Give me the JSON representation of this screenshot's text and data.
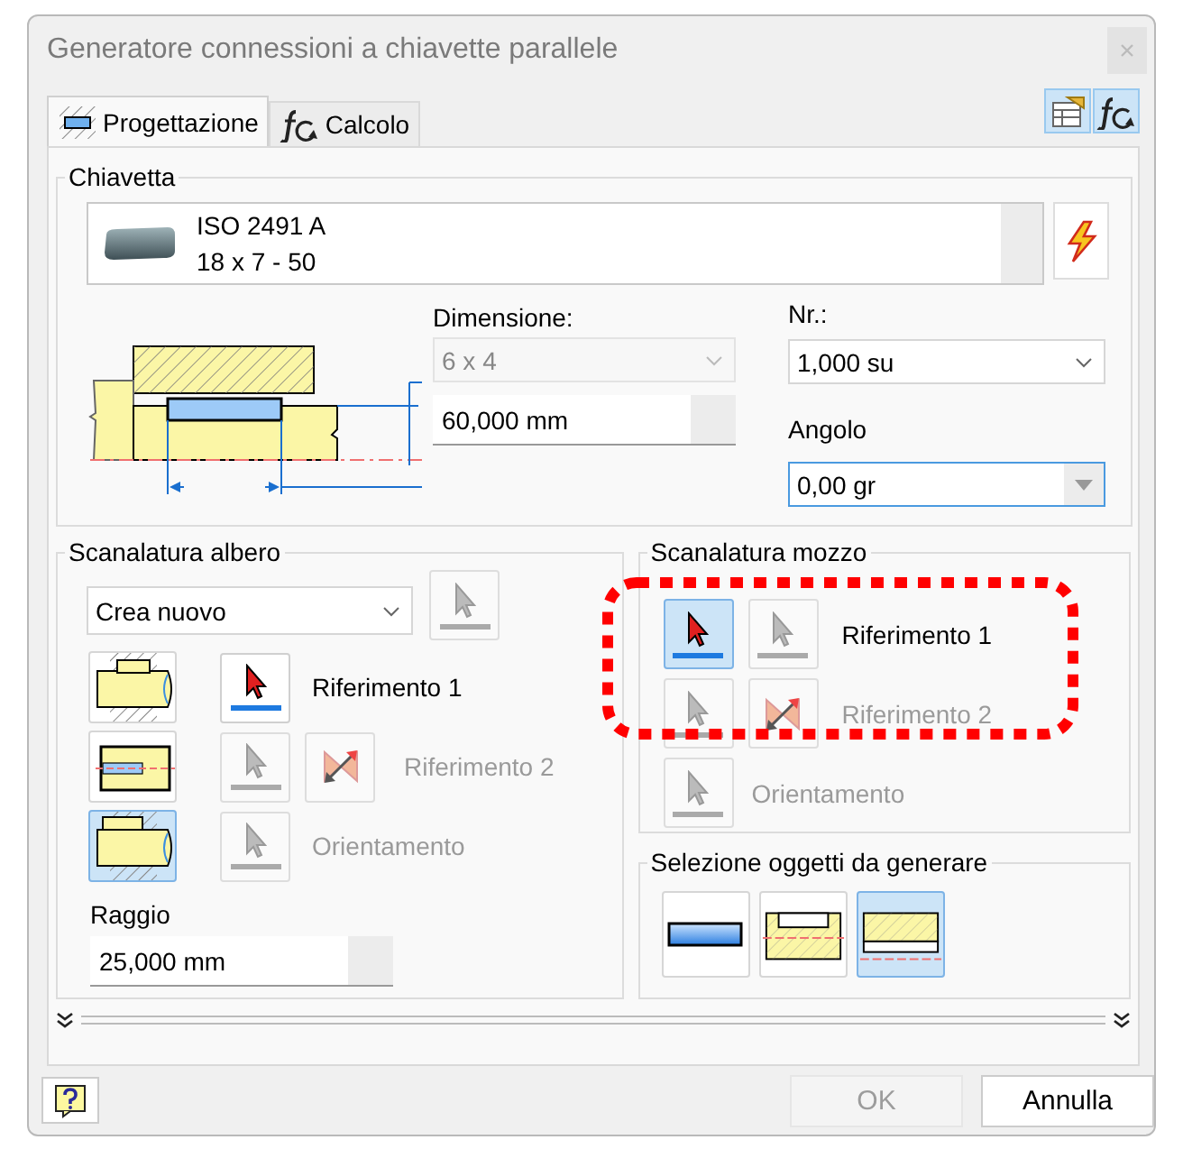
{
  "window": {
    "title": "Generatore connessioni a chiavette parallele"
  },
  "tabs": [
    {
      "label": "Progettazione",
      "kind": "design",
      "selected": true
    },
    {
      "label": "Calcolo",
      "kind": "formula",
      "selected": false
    }
  ],
  "toolbar_buttons": [
    {
      "kind": "table",
      "selected": true
    },
    {
      "kind": "formula",
      "selected": true
    }
  ],
  "key_section": {
    "title": "Chiavetta",
    "key_lines": [
      "ISO 2491 A",
      "18 x 7 - 50"
    ],
    "dimension": {
      "label": "Dimensione:",
      "value": "6 x 4",
      "disabled": true
    },
    "length": {
      "value": "60,000 mm"
    },
    "count": {
      "label": "Nr.:",
      "value": "1,000 su"
    },
    "angle": {
      "label": "Angolo",
      "value": "0,00 gr",
      "focused": true
    }
  },
  "shaft_groove": {
    "title": "Scanalatura albero",
    "mode": {
      "value": "Crea nuovo"
    },
    "mode_pick": {
      "disabled": true
    },
    "groove_types": [
      {
        "kind": "closed",
        "selected": false
      },
      {
        "kind": "flat",
        "selected": false
      },
      {
        "kind": "open",
        "selected": true
      }
    ],
    "references": [
      {
        "label": "Riferimento 1",
        "disabled": false,
        "buttons": [
          {
            "kind": "pick",
            "selected": false,
            "disabled": false
          }
        ]
      },
      {
        "label": "Riferimento 2",
        "disabled": true,
        "buttons": [
          {
            "kind": "pick",
            "selected": false,
            "disabled": true
          },
          {
            "kind": "flip",
            "selected": false,
            "disabled": true
          }
        ]
      },
      {
        "label": "Orientamento",
        "disabled": true,
        "buttons": [
          {
            "kind": "pick",
            "selected": false,
            "disabled": true
          }
        ]
      }
    ],
    "radius": {
      "label": "Raggio",
      "value": "25,000 mm"
    }
  },
  "hub_groove": {
    "title": "Scanalatura mozzo",
    "highlighted": true,
    "references": [
      {
        "label": "Riferimento 1",
        "disabled": false,
        "buttons": [
          {
            "kind": "pick",
            "selected": true,
            "disabled": false
          },
          {
            "kind": "pick",
            "selected": false,
            "disabled": true
          }
        ]
      },
      {
        "label": "Riferimento 2",
        "disabled": true,
        "buttons": [
          {
            "kind": "pick",
            "selected": false,
            "disabled": true
          },
          {
            "kind": "flip",
            "selected": false,
            "disabled": true
          }
        ]
      },
      {
        "label": "Orientamento",
        "disabled": true,
        "buttons": [
          {
            "kind": "pick",
            "selected": false,
            "disabled": true
          }
        ]
      }
    ]
  },
  "generate": {
    "title": "Selezione oggetti da generare",
    "options": [
      {
        "kind": "key",
        "selected": false
      },
      {
        "kind": "shaft-groove",
        "selected": false
      },
      {
        "kind": "hub-groove",
        "selected": true
      }
    ]
  },
  "footer": {
    "ok": {
      "label": "OK",
      "disabled": true
    },
    "cancel": {
      "label": "Annulla",
      "disabled": false
    }
  }
}
